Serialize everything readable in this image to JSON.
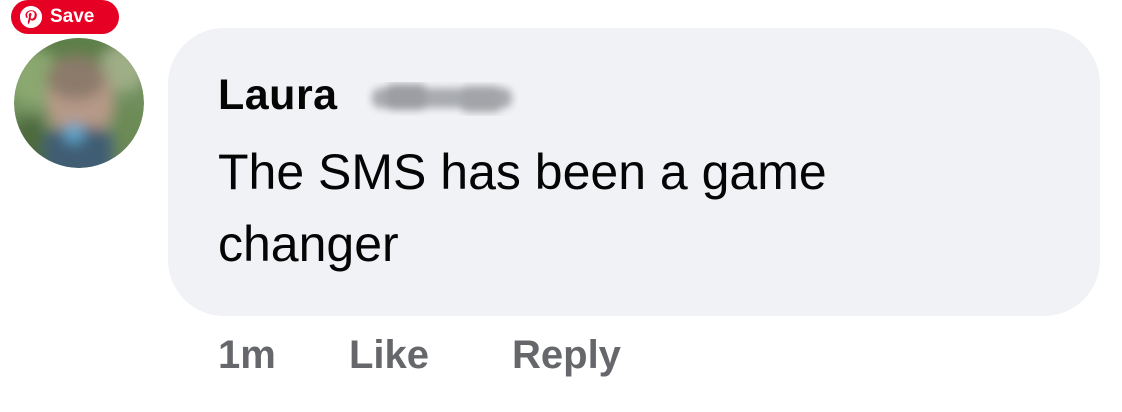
{
  "pinterest": {
    "save_label": "Save",
    "icon": "pinterest-icon",
    "brand_color": "#e60023"
  },
  "comment": {
    "author": "Laura",
    "author_surname_redacted": true,
    "text": "The SMS has been a game changer",
    "bubble_color": "#f0f2f5"
  },
  "actions": {
    "timestamp": "1m",
    "like_label": "Like",
    "reply_label": "Reply",
    "meta_color": "#65676b"
  }
}
